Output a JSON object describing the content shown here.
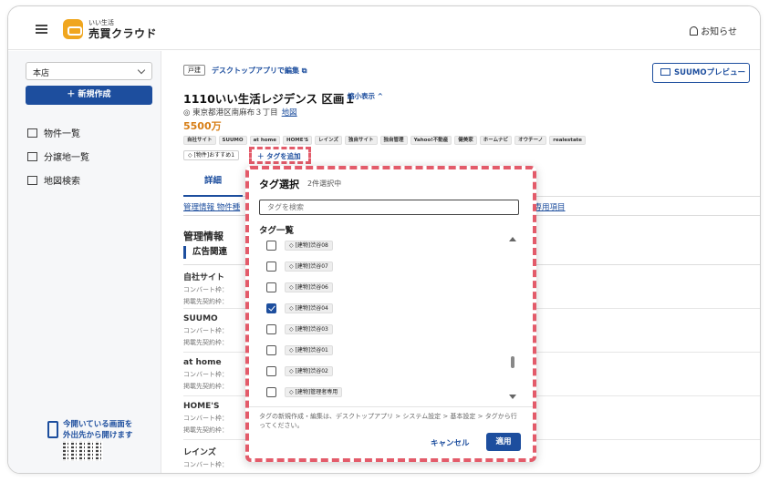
{
  "header": {
    "brand_small": "いい生活",
    "brand_main": "売買クラウド",
    "notice_label": "お知らせ"
  },
  "sidebar": {
    "store_select": "本店",
    "new_button": "＋ 新規作成",
    "items": [
      {
        "label": "物件一覧"
      },
      {
        "label": "分譲地一覧"
      },
      {
        "label": "地図検索"
      }
    ],
    "promo_line1": "今開いている画面を",
    "promo_line2": "外出先から開けます"
  },
  "property": {
    "type_badge": "戸建",
    "edit_link": "デスクトップアプリで編集",
    "suumo_button": "SUUMOプレビュー",
    "title": "1110いい生活レジデンス 区画１",
    "collapse": "縮小表示",
    "address": "東京都港区南麻布３丁目",
    "map_link": "地図",
    "price": "5500万",
    "portals": [
      "自社サイト",
      "SUUMO",
      "at home",
      "HOME'S",
      "レインズ",
      "独自サイト",
      "独自管理",
      "Yahoo!不動産",
      "健美家",
      "ホームナビ",
      "オウチーノ",
      "realestate"
    ],
    "selected_tag": "[物件]おすすめ1",
    "add_tag": "＋ タグを追加"
  },
  "tabs": {
    "detail": "詳細"
  },
  "subnav": {
    "left": "管理情報  物件種",
    "right": "者専用項目"
  },
  "section": {
    "title": "管理情報",
    "sub": "広告関連",
    "sites": [
      {
        "name": "自社サイト",
        "l1": "コンバート枠：",
        "l2": "掲載先契約枠："
      },
      {
        "name": "SUUMO",
        "l1": "コンバート枠：",
        "l2": "掲載先契約枠："
      },
      {
        "name": "at home",
        "l1": "コンバート枠：",
        "l2": "掲載先契約枠："
      },
      {
        "name": "HOME'S",
        "l1": "コンバート枠：",
        "l2": "掲載先契約枠："
      },
      {
        "name": "レインズ",
        "l1": "コンバート枠：",
        "l2": ""
      }
    ]
  },
  "modal": {
    "title": "タグ選択",
    "count": "2件選択中",
    "search_placeholder": "タグを検索",
    "list_title": "タグ一覧",
    "tags": [
      {
        "label": "[建物]渋谷08",
        "checked": false
      },
      {
        "label": "[建物]渋谷07",
        "checked": false
      },
      {
        "label": "[建物]渋谷06",
        "checked": false
      },
      {
        "label": "[建物]渋谷04",
        "checked": true
      },
      {
        "label": "[建物]渋谷03",
        "checked": false
      },
      {
        "label": "[建物]渋谷01",
        "checked": false
      },
      {
        "label": "[建物]渋谷02",
        "checked": false
      },
      {
        "label": "[建物]管理者専用",
        "checked": false
      }
    ],
    "note": "タグの新規作成・編集は、デスクトップアプリ > システム設定 > 基本設定 > タグから行ってください。",
    "cancel": "キャンセル",
    "apply": "適用"
  },
  "colors": {
    "primary": "#1d4e9e",
    "price": "#d77d14",
    "highlight": "#e35b6a"
  }
}
